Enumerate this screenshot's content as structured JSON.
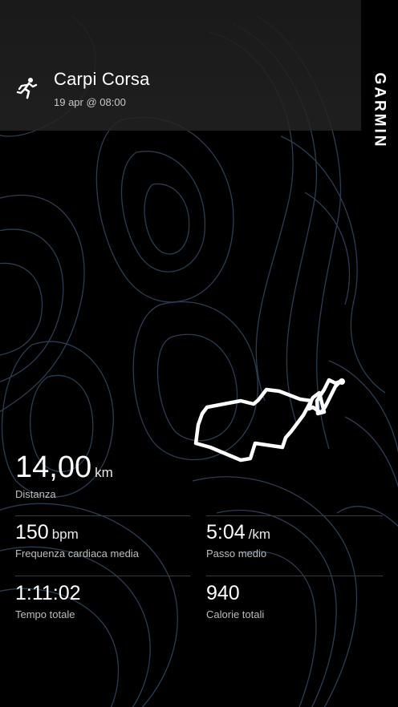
{
  "activity": {
    "title": "Carpi Corsa",
    "date": "19 apr @ 08:00",
    "icon": "running-person-icon"
  },
  "brand": {
    "name": "GARMIN"
  },
  "stats": {
    "distance": {
      "value": "14,00",
      "unit": "km",
      "label": "Distanza"
    },
    "heart_rate": {
      "value": "150",
      "unit": "bpm",
      "label": "Frequenza cardiaca media"
    },
    "pace": {
      "value": "5:04",
      "unit": "/km",
      "label": "Passo medio"
    },
    "total_time": {
      "value": "1:11:02",
      "label": "Tempo totale"
    },
    "calories": {
      "value": "940",
      "label": "Calorie totali"
    }
  },
  "colors": {
    "background": "#000000",
    "contour": "#2c3d52",
    "route": "#ffffff"
  }
}
